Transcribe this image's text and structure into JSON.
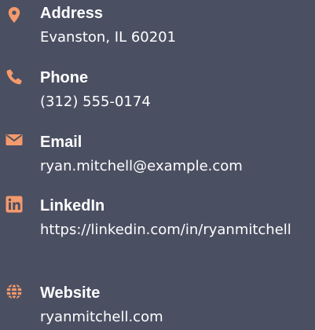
{
  "colors": {
    "background": "#4b4f62",
    "accent": "#f49a6c",
    "label": "#ffffff",
    "value": "#ffffff"
  },
  "contacts": [
    {
      "icon": "map-pin-icon",
      "label": "Address",
      "value": "Evanston, IL 60201"
    },
    {
      "icon": "phone-icon",
      "label": "Phone",
      "value": "(312) 555-0174"
    },
    {
      "icon": "envelope-icon",
      "label": "Email",
      "value": "ryan.mitchell@example.com"
    },
    {
      "icon": "linkedin-icon",
      "label": "LinkedIn",
      "value": "https://linkedin.com/in/ryanmitchell"
    },
    {
      "icon": "globe-icon",
      "label": "Website",
      "value": "ryanmitchell.com"
    }
  ]
}
